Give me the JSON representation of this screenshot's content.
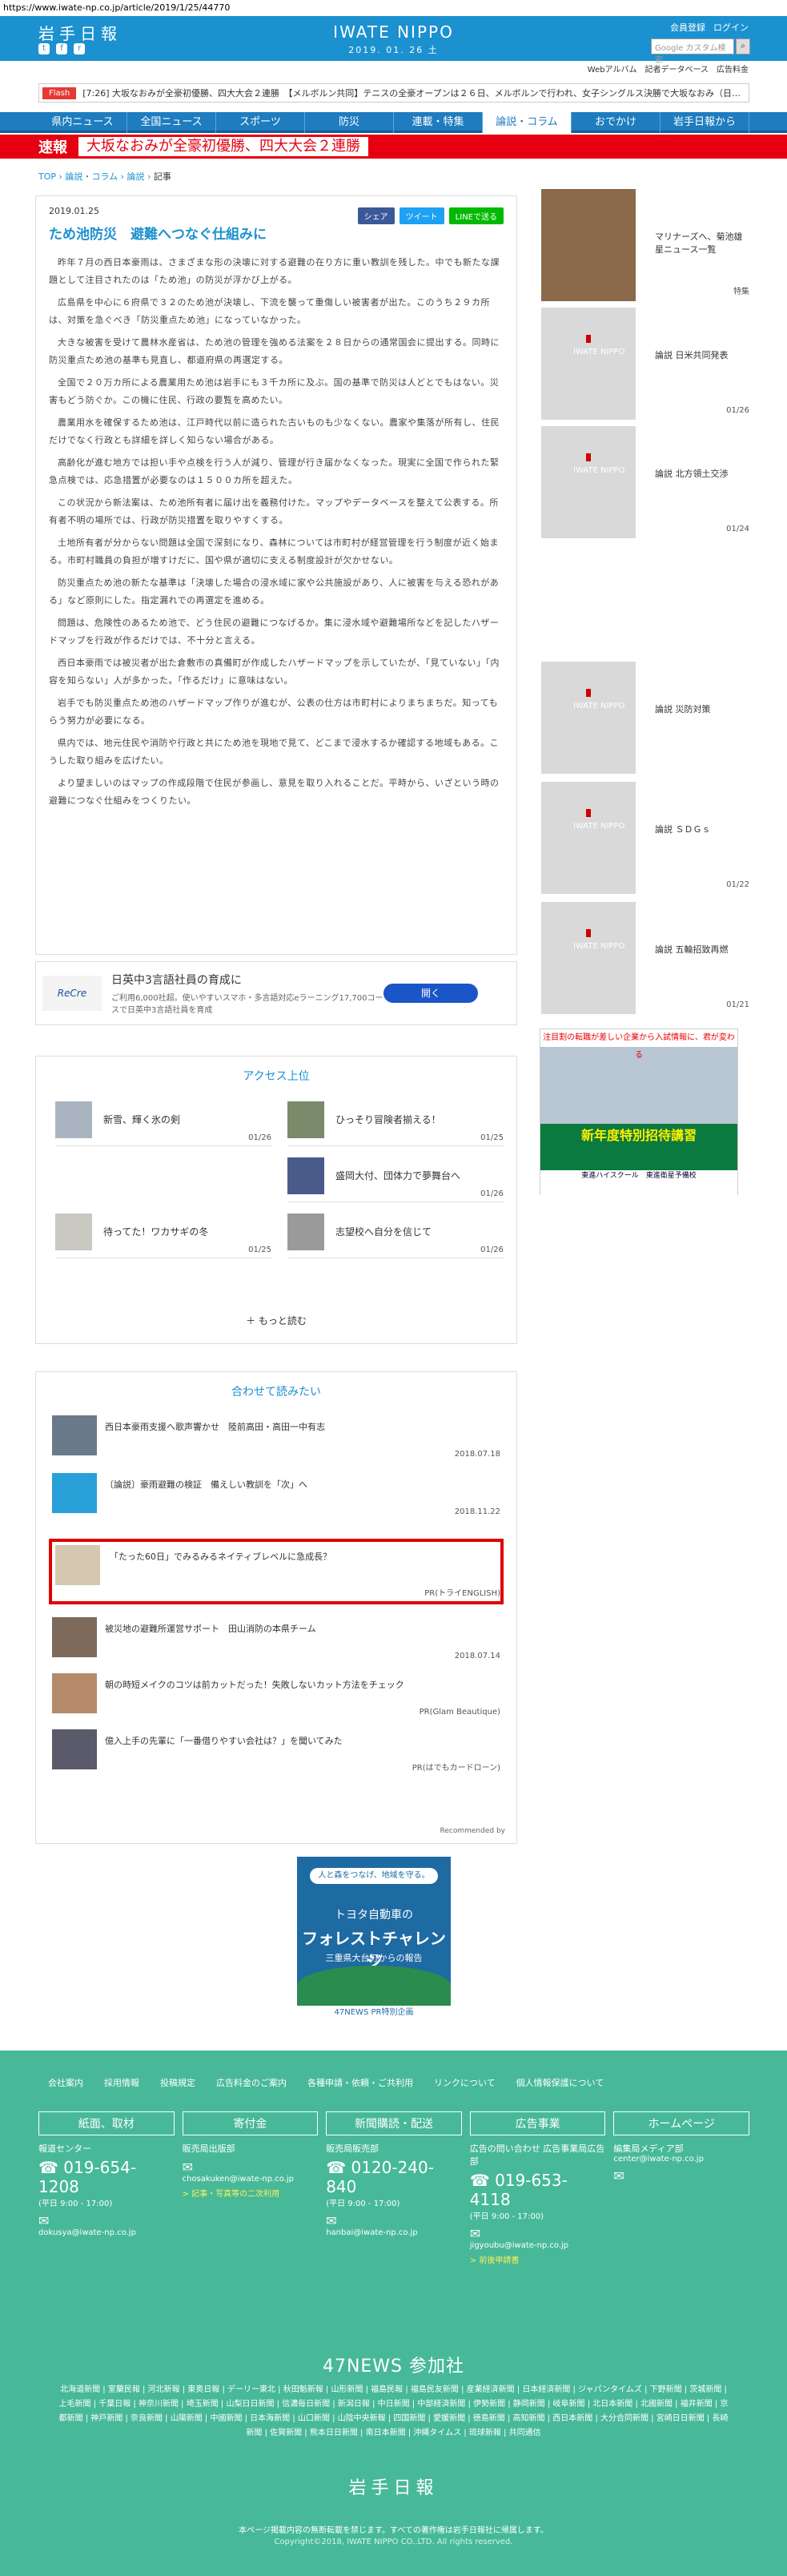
{
  "browser": {
    "url": "https://www.iwate-np.co.jp/article/2019/1/25/44770"
  },
  "header": {
    "logo": "岩手日報",
    "brand": "IWATE NIPPO",
    "date": "2019. 01. 26 土",
    "links": [
      "会員登録",
      "ログイン"
    ],
    "search_placeholder": "Google カスタム検索",
    "subnav": [
      "Webアルバム",
      "記者データベース",
      "広告料金"
    ]
  },
  "flash": {
    "label": "Flash",
    "text": "[7:26] 大坂なおみが全豪初優勝、四大大会２連勝　【メルボルン共同】テニスの全豪オープンは２６日、メルボルンで行われ、女子シングルス決勝で大坂なおみ（日…"
  },
  "gnav": [
    "県内ニュース",
    "全国ニュース",
    "スポーツ",
    "防災",
    "連載・特集",
    "論説・コラム",
    "おでかけ",
    "岩手日報から"
  ],
  "breaking": {
    "label": "速報",
    "text": "大坂なおみが全豪初優勝、四大大会２連勝"
  },
  "breadcrumb": {
    "items": [
      "TOP",
      "論説・コラム",
      "論説"
    ],
    "current": "記事"
  },
  "article": {
    "date": "2019.01.25",
    "title": "ため池防災　避難へつなぐ仕組みに",
    "share": [
      "シェア",
      "ツイート",
      "LINEで送る"
    ],
    "paragraphs": [
      "昨年７月の西日本豪雨は、さまざまな形の決壊に対する避難の在り方に重い教訓を残した。中でも新たな課題として注目されたのは「ため池」の防災が浮かび上がる。",
      "広島県を中心に６府県で３２のため池が決壊し、下流を襲って重傷しい被害者が出た。このうち２９カ所は、対策を急ぐべき「防災重点ため池」になっていなかった。",
      "大きな被害を受けて農林水産省は、ため池の管理を強める法案を２８日からの通常国会に提出する。同時に防災重点ため池の基準も見直し、都道府県の再選定する。",
      "全国で２０万カ所による農業用ため池は岩手にも３千カ所に及ぶ。国の基準で防災は人どとでもはない。災害もどう防ぐか。この機に住民、行政の要覧を高めたい。",
      "農業用水を確保するため池は、江戸時代以前に造られた古いものも少なくない。農家や集落が所有し、住民だけでなく行政とも詳細を詳しく知らない場合がある。",
      "高齢化が進む地方では担い手や点検を行う人が減り、管理が行き届かなくなった。現実に全国で作られた緊急点検では、応急措置が必要なのは１５００カ所を超えた。",
      "この状況から新法案は、ため池所有者に届け出を義務付けた。マップやデータベースを整えて公表する。所有者不明の場所では、行政が防災措置を取りやすくする。",
      "土地所有者が分からない問題は全国で深刻になり、森林については市町村が経営管理を行う制度が近く始まる。市町村職員の負担が増すけだに、国や県が適切に支える制度設計が欠かせない。",
      "防災重点ため池の新たな基準は「決壊した場合の浸水域に家や公共施設があり、人に被害を与える恐れがある」など原則にした。指定漏れでの再選定を進める。",
      "問題は、危険性のあるため池で、どう住民の避難につなげるか。集に浸水域や避難場所などを記したハザードマップを行政が作るだけでは、不十分と言える。",
      "西日本豪雨では被災者が出た倉敷市の真備町が作成したハザードマップを示していたが、「見ていない」「内容を知らない」人が多かった。「作るだけ」に意味はない。",
      "岩手でも防災重点ため池のハザードマップ作りが進むが、公表の仕方は市町村によりまちまちだ。知ってもらう努力が必要になる。",
      "県内では、地元住民や消防や行政と共にため池を現地で見て、どこまで浸水するか確認する地域もある。こうした取り組みを広げたい。",
      "より望ましいのはマップの作成段階で住民が参画し、意見を取り入れることだ。平時から、いざという時の避難につなぐ仕組みをつくりたい。"
    ]
  },
  "ad": {
    "logo": "ReCre",
    "title": "日英中3言語社員の育成に",
    "sub": "ご利用6,000社超。使いやすいスマホ・多言語対応eラーニング17,700コースで日英中3言語社員を育成",
    "button": "開く"
  },
  "ranking": {
    "title": "アクセス上位",
    "items": [
      {
        "title": "新雪、輝く氷の剣",
        "date": "01/26"
      },
      {
        "title": "ひっそり冒険者揃える！",
        "date": "01/25"
      },
      {
        "title": "盛岡大付、団体力で夢舞台へ",
        "date": "01/26"
      },
      {
        "title": "待ってた！ワカサギの冬",
        "date": "01/25"
      },
      {
        "title": "志望校へ自分を信じて",
        "date": "01/26"
      }
    ],
    "more": "もっと読む"
  },
  "recommend": {
    "title": "合わせて読みたい",
    "items": [
      {
        "title": "西日本豪雨支援へ歌声響かせ　陸前高田・高田一中有志",
        "date": "2018.07.18"
      },
      {
        "title": "〔論説〕豪雨避難の検証　備えしい教訓を「次」へ",
        "date": "2018.11.22"
      },
      {
        "title": "「たった60日」でみるみるネイティブレベルに急成長？",
        "date": "PR(トライENGLISH)"
      },
      {
        "title": "被災地の避難所運営サポート　田山消防の本県チーム",
        "date": "2018.07.14"
      },
      {
        "title": "朝の時短メイクのコツは前カットだった！失敗しないカット方法をチェック",
        "date": "PR(Glam Beautique)"
      },
      {
        "title": "億入上手の先輩に「一番借りやすい会社は？」を聞いてみた",
        "date": "PR(はでもカードローン)"
      }
    ],
    "powered": "Recommended by"
  },
  "banner_ad": {
    "slogan": "人と森をつなげ、地域を守る。",
    "line1": "トヨタ自動車の",
    "line2": "フォレストチャレンジ",
    "line3": "三重県大台町からの報告",
    "footer": "47NEWS PR特別企画"
  },
  "sidebar": {
    "items": [
      {
        "title": "マリナーズへ、菊池雄星ニュース一覧",
        "date": "特集"
      },
      {
        "title": "論説 日米共同発表",
        "date": "01/26"
      },
      {
        "title": "論説 北方領土交渉",
        "date": "01/24"
      },
      {
        "title": "論説 災防対策",
        "date": ""
      },
      {
        "title": "論説 ＳＤＧｓ",
        "date": "01/22"
      },
      {
        "title": "論説 五輪招致再燃",
        "date": "01/21"
      }
    ],
    "thumb_label": "IWATE NIPPO",
    "ad": {
      "top": "注目割の転職が差しい企業から入試情報に、君が変わる",
      "banner": "新年度特別招待講習",
      "bottom": "東進ハイスクール　東進衛星予備校"
    }
  },
  "footer": {
    "links": [
      "会社案内",
      "採用情報",
      "投稿規定",
      "広告料金のご案内",
      "各種申請・依頼・ご共利用",
      "リンクについて",
      "個人情報保護について"
    ],
    "cols": [
      {
        "head": "紙面、取材",
        "s1": "報道センター",
        "tel": "019-654-1208",
        "hours": "(平日 9:00 - 17:00)",
        "mail": "dokusya@iwate-np.co.jp",
        "link": ""
      },
      {
        "head": "寄付金",
        "s1": "販売局出版部",
        "tel": "",
        "hours": "",
        "mail": "chosakuken@iwate-np.co.jp",
        "link": "> 記事・写真等の二次利用"
      },
      {
        "head": "新聞購読・配送",
        "s1": "販売局販売部",
        "tel": "0120-240-840",
        "hours": "(平日 9:00 - 17:00)",
        "mail": "hanbai@iwate-np.co.jp",
        "link": ""
      },
      {
        "head": "広告事業",
        "s1": "広告の問い合わせ 広告事業局広告部",
        "tel": "019-653-4118",
        "hours": "(平日 9:00 - 17:00)",
        "mail": "jigyoubu@iwate-np.co.jp",
        "link": "> 前後申請書"
      },
      {
        "head": "ホームページ",
        "s1": "編集局メディア部",
        "tel": "",
        "hours": "",
        "mail": "center@iwate-np.co.jp",
        "link": ""
      }
    ],
    "n47_title": "47NEWS 参加社",
    "n47_list": "北海道新聞 | 室蘭民報 | 河北新報 | 東奥日報 | デーリー東北 | 秋田魁新報 | 山形新聞 | 福島民報 | 福島民友新聞 | 産業経済新聞 | 日本経済新聞 | ジャパンタイムズ | 下野新聞 | 茨城新聞 | 上毛新聞 | 千葉日報 | 神奈川新聞 | 埼玉新聞 | 山梨日日新聞 | 信濃毎日新聞 | 新潟日報 | 中日新聞 | 中部経済新聞 | 伊勢新聞 | 静岡新聞 | 岐阜新聞 | 北日本新聞 | 北國新聞 | 福井新聞 | 京都新聞 | 神戸新聞 | 奈良新聞 | 山陽新聞 | 中國新聞 | 日本海新聞 | 山口新聞 | 山陰中央新報 | 四国新聞 | 愛媛新聞 | 徳島新聞 | 高知新聞 | 西日本新聞 | 大分合同新聞 | 宮崎日日新聞 | 長崎新聞 | 佐賀新聞 | 熊本日日新聞 | 南日本新聞 | 沖縄タイムス | 琉球新報 | 共同通信",
    "logo": "岩手日報",
    "copy1": "本ページ掲載内容の無断転載を禁じます。すべての著作権は岩手日報社に帰属します。",
    "copy2": "Copyright©2018, IWATE NIPPO CO.,LTD. All rights reserved."
  }
}
